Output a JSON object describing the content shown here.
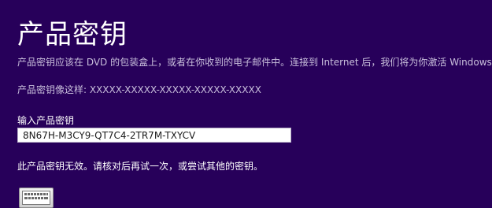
{
  "page": {
    "title": "产品密钥",
    "description": "产品密钥应该在 DVD 的包装盒上，或者在你收到的电子邮件中。连接到 Internet 后，我们将为你激活 Windows。",
    "example_text": "产品密钥像这样: XXXXX-XXXXX-XXXXX-XXXXX-XXXXX",
    "input_label": "输入产品密钥",
    "key_value": "8N67H-M3CY9-QT7C4-2TR7M-TXYCV",
    "error_message": "此产品密钥无效。请核对后再试一次，或尝试其他的密钥。"
  },
  "icons": {
    "keyboard": "on-screen-keyboard-icon"
  },
  "colors": {
    "background": "#27005a",
    "text": "#ffffff",
    "secondary_text": "#c9bfdc"
  }
}
